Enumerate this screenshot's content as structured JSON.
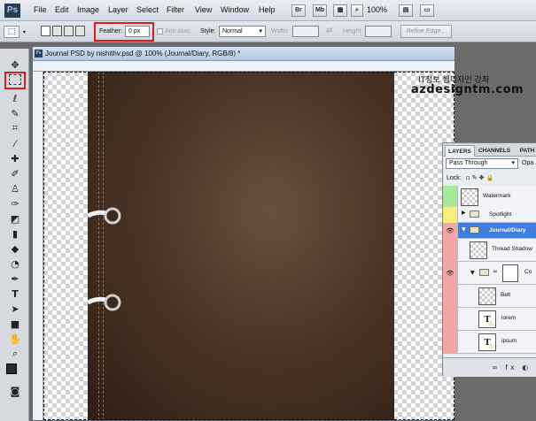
{
  "app": {
    "logo": "Ps"
  },
  "menu": [
    "File",
    "Edit",
    "Image",
    "Layer",
    "Select",
    "Filter",
    "View",
    "Window",
    "Help"
  ],
  "menubar_buttons": [
    "Br",
    "Mb"
  ],
  "zoom": "100%",
  "options": {
    "feather_label": "Feather:",
    "feather_value": "0 px",
    "antialias_label": "Anti-alias",
    "style_label": "Style:",
    "style_value": "Normal",
    "width_label": "Width:",
    "height_label": "Height:",
    "refine_edge": "Refine Edge..."
  },
  "document": {
    "title": "Journal PSD by nishithv.psd @ 100% (Journal/Diary, RGB/8) *"
  },
  "layers_panel": {
    "tabs": [
      "LAYERS",
      "CHANNELS",
      "PATH"
    ],
    "blend_mode": "Pass Through",
    "opacity_label": "Opa",
    "lock_label": "Lock:",
    "layers": [
      {
        "name": "Watermark",
        "eye_color": "#a8e89a"
      },
      {
        "name": "Spotlight",
        "eye_color": "#f5f07a"
      },
      {
        "name": "Journal/Diary",
        "eye_color": "#f2a7a7"
      },
      {
        "name": "Thread Shadow",
        "eye_color": "#f2a7a7"
      },
      {
        "name": "Co",
        "eye_color": "#f2a7a7"
      },
      {
        "name": "Belt",
        "eye_color": "#f2a7a7"
      },
      {
        "name": "lorem",
        "eye_color": "#f2a7a7"
      },
      {
        "name": "ipsum",
        "eye_color": "#f2a7a7"
      }
    ]
  },
  "watermark": {
    "line1": "IT정보 웹디자인 강좌",
    "line2": "azdesigntm.com"
  },
  "colors": {
    "highlight": "#e01b1b",
    "selected_layer": "#3d7de0"
  }
}
